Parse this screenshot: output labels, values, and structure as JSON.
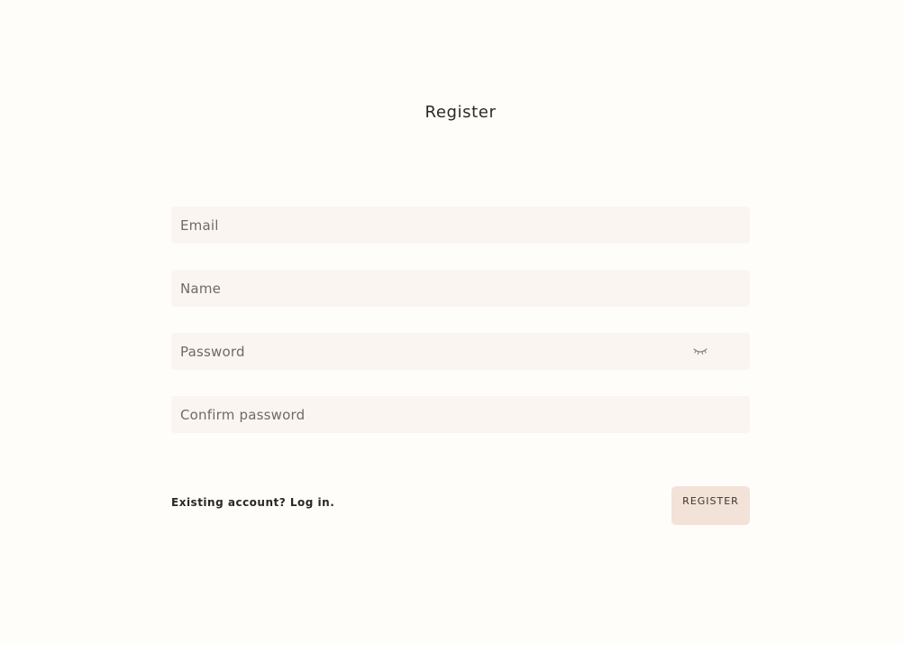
{
  "page": {
    "title": "Register"
  },
  "form": {
    "email_placeholder": "Email",
    "name_placeholder": "Name",
    "password_placeholder": "Password",
    "confirm_password_placeholder": "Confirm password",
    "password_toggle_icon": "eye-closed-icon"
  },
  "footer": {
    "login_link": "Existing account? Log in.",
    "register_button": "REGISTER"
  },
  "colors": {
    "background": "#fefdfa",
    "input_background": "#faf5f1",
    "button_background": "#f2e2d7",
    "text": "#2a2724",
    "placeholder": "#6f6a66"
  }
}
